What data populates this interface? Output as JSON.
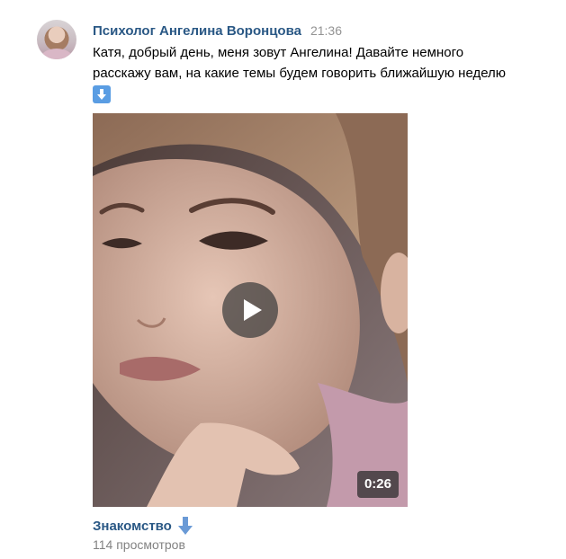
{
  "post": {
    "author": "Психолог Ангелина Воронцова",
    "time": "21:36",
    "text_line1": "Катя, добрый день, меня зовут Ангелина! Давайте немного",
    "text_line2": "расскажу вам, на какие темы будем говорить ближайшую неделю",
    "text_emoji": "down-arrow-emoji"
  },
  "video": {
    "duration": "0:26",
    "title": "Знакомство",
    "title_emoji": "down-arrow-icon",
    "views": "114 просмотров"
  },
  "colors": {
    "link": "#2a5885",
    "time": "#939393",
    "views": "#828282",
    "emoji_blue": "#5a9de3"
  }
}
